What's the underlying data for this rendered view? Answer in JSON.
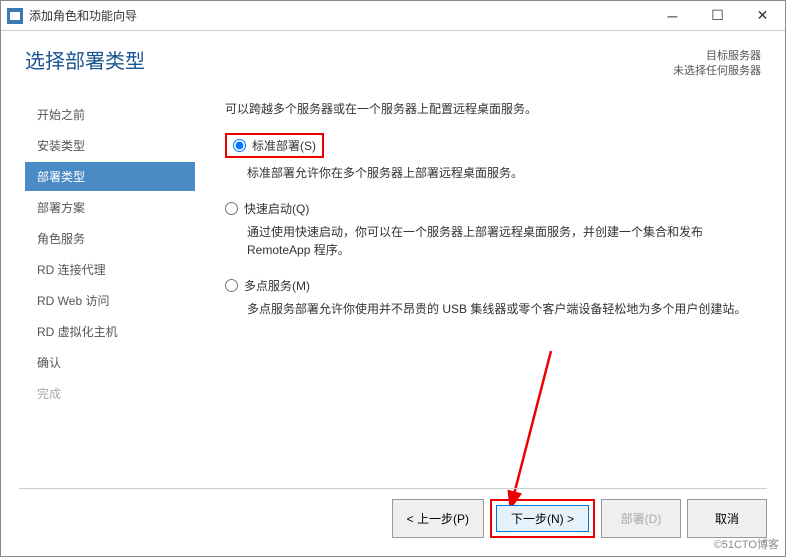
{
  "titlebar": {
    "title": "添加角色和功能向导"
  },
  "header": {
    "page_title": "选择部署类型",
    "target_label": "目标服务器",
    "target_status": "未选择任何服务器"
  },
  "sidebar": {
    "items": [
      {
        "label": "开始之前",
        "state": "normal"
      },
      {
        "label": "安装类型",
        "state": "normal"
      },
      {
        "label": "部署类型",
        "state": "active"
      },
      {
        "label": "部署方案",
        "state": "normal"
      },
      {
        "label": "角色服务",
        "state": "normal"
      },
      {
        "label": "RD 连接代理",
        "state": "normal"
      },
      {
        "label": "RD Web 访问",
        "state": "normal"
      },
      {
        "label": "RD 虚拟化主机",
        "state": "normal"
      },
      {
        "label": "确认",
        "state": "normal"
      },
      {
        "label": "完成",
        "state": "disabled"
      }
    ]
  },
  "main": {
    "intro": "可以跨越多个服务器或在一个服务器上配置远程桌面服务。",
    "options": [
      {
        "label": "标准部署(S)",
        "checked": true,
        "highlighted": true,
        "desc": "标准部署允许你在多个服务器上部署远程桌面服务。"
      },
      {
        "label": "快速启动(Q)",
        "checked": false,
        "highlighted": false,
        "desc": "通过使用快速启动，你可以在一个服务器上部署远程桌面服务，并创建一个集合和发布 RemoteApp 程序。"
      },
      {
        "label": "多点服务(M)",
        "checked": false,
        "highlighted": false,
        "desc": "多点服务部署允许你使用并不昂贵的 USB 集线器或零个客户端设备轻松地为多个用户创建站。"
      }
    ]
  },
  "footer": {
    "prev": "< 上一步(P)",
    "next": "下一步(N) >",
    "deploy": "部署(D)",
    "cancel": "取消"
  },
  "watermark": "©51CTO博客"
}
